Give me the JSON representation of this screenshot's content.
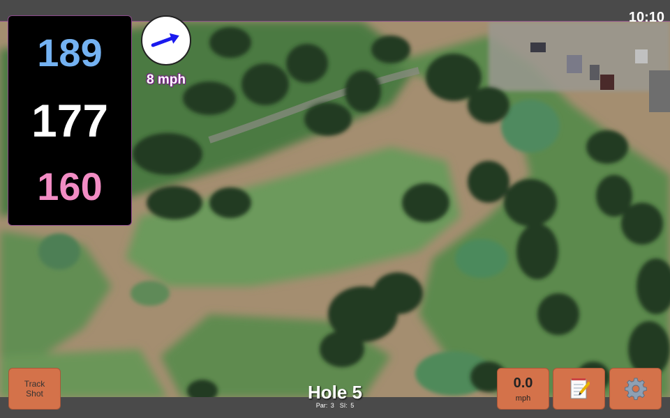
{
  "status_bar": {
    "time": "10:10"
  },
  "distances": {
    "back": "189",
    "middle": "177",
    "front": "160",
    "colors": {
      "back": "#74b2f2",
      "middle": "#ffffff",
      "front": "#f28cc4"
    }
  },
  "wind": {
    "speed_label": "8 mph",
    "direction_icon": "arrow-east-northeast-icon",
    "arrow_color": "#1a1aee"
  },
  "buttons": {
    "track_shot_label": "Track Shot",
    "speed_value": "0.0",
    "speed_unit": "mph",
    "notes_icon": "notepad-icon",
    "settings_icon": "gear-icon",
    "button_color": "#d4724a"
  },
  "hole": {
    "title": "Hole 5",
    "par": "Par: 3",
    "si": "SI: 5"
  }
}
